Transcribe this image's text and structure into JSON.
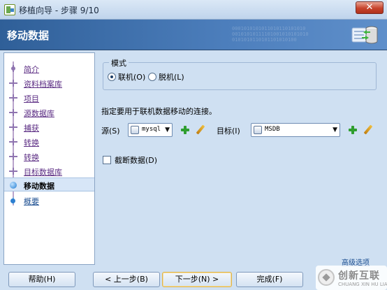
{
  "window": {
    "title": "移植向导 - 步骤 9/10",
    "close_label": "✕",
    "icon": "wizard-app-icon"
  },
  "header": {
    "title": "移动数据",
    "binary_lines": [
      "0001010101011010110101010",
      "00101010111101001010101010",
      "0101010110101101010100"
    ],
    "graphic": "database-transfer-icon"
  },
  "sidebar": {
    "steps": [
      {
        "label": "简介",
        "state": "done"
      },
      {
        "label": "资料档案库",
        "state": "done"
      },
      {
        "label": "项目",
        "state": "done"
      },
      {
        "label": "源数据库",
        "state": "done"
      },
      {
        "label": "捕获",
        "state": "done"
      },
      {
        "label": "转换",
        "state": "done"
      },
      {
        "label": "转换",
        "state": "done"
      },
      {
        "label": "目标数据库",
        "state": "done"
      },
      {
        "label": "移动数据",
        "state": "current"
      },
      {
        "label": "概要",
        "state": "future"
      }
    ]
  },
  "mode": {
    "legend": "模式",
    "online_label": "联机(O)",
    "offline_label": "脱机(L)",
    "selected": "online"
  },
  "instruction": "指定要用于联机数据移动的连接。",
  "source": {
    "label": "源(S)",
    "value": "mysql",
    "icon": "database-connection-icon"
  },
  "target": {
    "label": "目标(I)",
    "value": "MSDB",
    "icon": "database-connection-icon"
  },
  "truncate": {
    "label": "截断数据(D)",
    "checked": false
  },
  "advanced_link": "高级选项",
  "buttons": {
    "help": "帮助(H)",
    "back": "< 上一步(B)",
    "next": "下一步(N) >",
    "finish": "完成(F)"
  },
  "watermark": {
    "cn": "创新互联",
    "en": "CHUANG XIN HU LIAN"
  },
  "colors": {
    "header_bg": "#3a6aa8",
    "content_bg": "#cfe0f2",
    "visited_link": "#5b2c83",
    "add_icon": "#2f9e2f",
    "close_button": "#c7442c"
  }
}
